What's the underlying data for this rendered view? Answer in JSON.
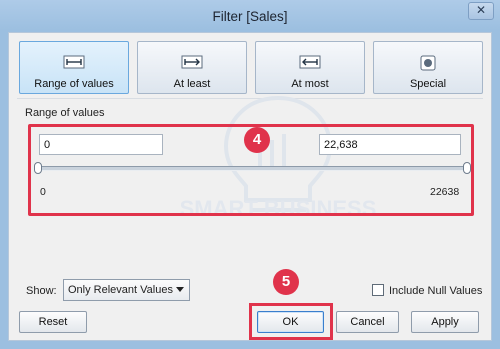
{
  "window": {
    "title": "Filter [Sales]",
    "close_glyph": "✕"
  },
  "filter_types": [
    {
      "label": "Range of values",
      "icon": "range-of-values-icon",
      "active": true
    },
    {
      "label": "At least",
      "icon": "at-least-icon",
      "active": false
    },
    {
      "label": "At most",
      "icon": "at-most-icon",
      "active": false
    },
    {
      "label": "Special",
      "icon": "special-icon",
      "active": false
    }
  ],
  "range": {
    "section_label": "Range of values",
    "min_value": "0",
    "max_value": "22,638",
    "slider_min_label": "0",
    "slider_max_label": "22638"
  },
  "annotations": {
    "badge_range": "4",
    "badge_ok": "5",
    "color": "#e0334b"
  },
  "watermark": {
    "text": "SMART BUSINESS"
  },
  "show": {
    "label": "Show:",
    "selected": "Only Relevant Values"
  },
  "include_null": {
    "label": "Include Null Values",
    "checked": false
  },
  "buttons": {
    "reset": "Reset",
    "ok": "OK",
    "cancel": "Cancel",
    "apply": "Apply"
  },
  "colors": {
    "accent": "#6aa8de",
    "title_bar": "#9cbfe0"
  }
}
